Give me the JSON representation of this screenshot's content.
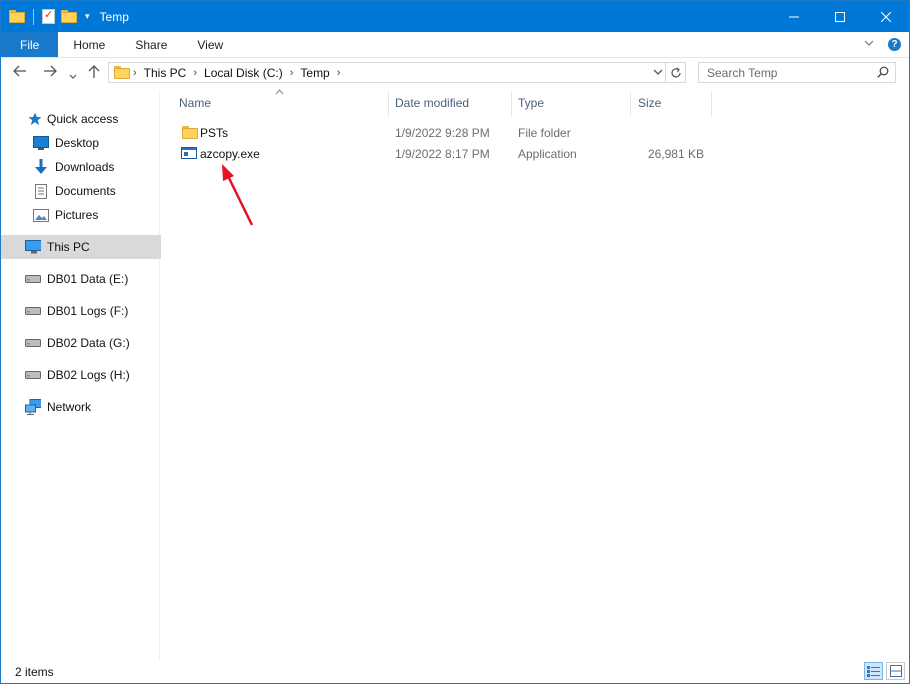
{
  "window": {
    "title": "Temp"
  },
  "ribbon": {
    "tabs": [
      "File",
      "Home",
      "Share",
      "View"
    ]
  },
  "address": {
    "crumbs": [
      "This PC",
      "Local Disk (C:)",
      "Temp"
    ],
    "search_placeholder": "Search Temp"
  },
  "nav": {
    "quick_access": "Quick access",
    "items": [
      {
        "label": "Desktop",
        "icon": "desktop-icon",
        "pinned": true
      },
      {
        "label": "Downloads",
        "icon": "downloads-icon",
        "pinned": true
      },
      {
        "label": "Documents",
        "icon": "documents-icon",
        "pinned": true
      },
      {
        "label": "Pictures",
        "icon": "pictures-icon",
        "pinned": true
      }
    ],
    "this_pc": "This PC",
    "drives": [
      "DB01 Data (E:)",
      "DB01 Logs (F:)",
      "DB02 Data (G:)",
      "DB02 Logs (H:)"
    ],
    "network": "Network"
  },
  "columns": {
    "name": "Name",
    "date": "Date modified",
    "type": "Type",
    "size": "Size"
  },
  "files": [
    {
      "name": "PSTs",
      "date": "1/9/2022 9:28 PM",
      "type": "File folder",
      "size": "",
      "icon": "folder-icon"
    },
    {
      "name": "azcopy.exe",
      "date": "1/9/2022 8:17 PM",
      "type": "Application",
      "size": "26,981 KB",
      "icon": "application-icon"
    }
  ],
  "status": {
    "count": "2 items"
  },
  "colors": {
    "titlebar": "#0078d7",
    "accent": "#1979ca",
    "annotation_arrow": "#e81123"
  }
}
